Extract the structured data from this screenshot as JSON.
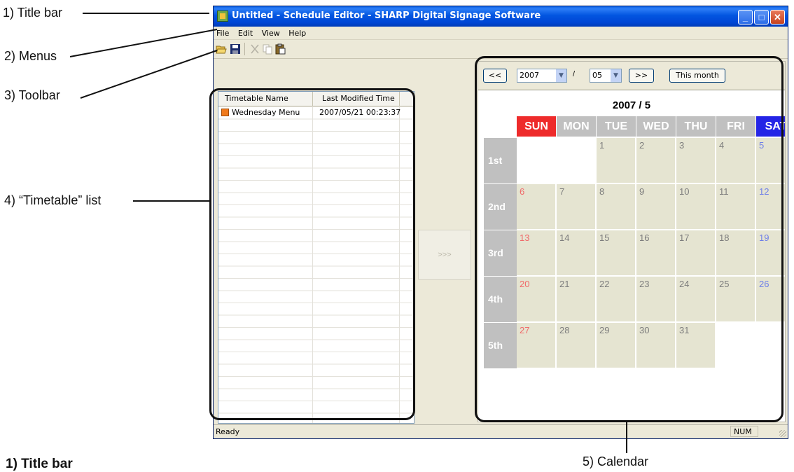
{
  "annotations": {
    "title_bar": "1) Title bar",
    "menus": "2) Menus",
    "toolbar": "3) Toolbar",
    "timetable_list": "4) “Timetable” list",
    "calendar": "5) Calendar",
    "footer_heading": "1) Title bar"
  },
  "window": {
    "title": "Untitled - Schedule Editor - SHARP Digital Signage Software",
    "title_color": "#0055e5"
  },
  "menus": [
    "File",
    "Edit",
    "View",
    "Help"
  ],
  "toolbar": {
    "icons": [
      "open-folder-icon",
      "save-icon",
      "cut-icon",
      "copy-icon",
      "paste-icon"
    ]
  },
  "timetable": {
    "columns": [
      "Timetable Name",
      "Last Modified Time"
    ],
    "rows": [
      {
        "name": "Wednesday Menu",
        "modified": "2007/05/21 00:23:37",
        "color": "#f07a1c"
      }
    ]
  },
  "move_button": ">>>",
  "calendar": {
    "prev_label": "<<",
    "next_label": ">>",
    "year": "2007",
    "month": "05",
    "separator": "/",
    "this_month_label": "This month",
    "heading": "2007 / 5",
    "days": [
      "SUN",
      "MON",
      "TUE",
      "WED",
      "THU",
      "FRI",
      "SAT"
    ],
    "day_colors": [
      "#ee2b2b",
      "#c0c0c0",
      "#c0c0c0",
      "#c0c0c0",
      "#c0c0c0",
      "#c0c0c0",
      "#2424e6"
    ],
    "weeks": [
      "1st",
      "2nd",
      "3rd",
      "4th",
      "5th"
    ],
    "grid": [
      [
        "",
        "",
        "1",
        "2",
        "3",
        "4",
        "5"
      ],
      [
        "6",
        "7",
        "8",
        "9",
        "10",
        "11",
        "12"
      ],
      [
        "13",
        "14",
        "15",
        "16",
        "17",
        "18",
        "19"
      ],
      [
        "20",
        "21",
        "22",
        "23",
        "24",
        "25",
        "26"
      ],
      [
        "27",
        "28",
        "29",
        "30",
        "31",
        "",
        ""
      ]
    ]
  },
  "status": {
    "text": "Ready",
    "num": "NUM"
  }
}
